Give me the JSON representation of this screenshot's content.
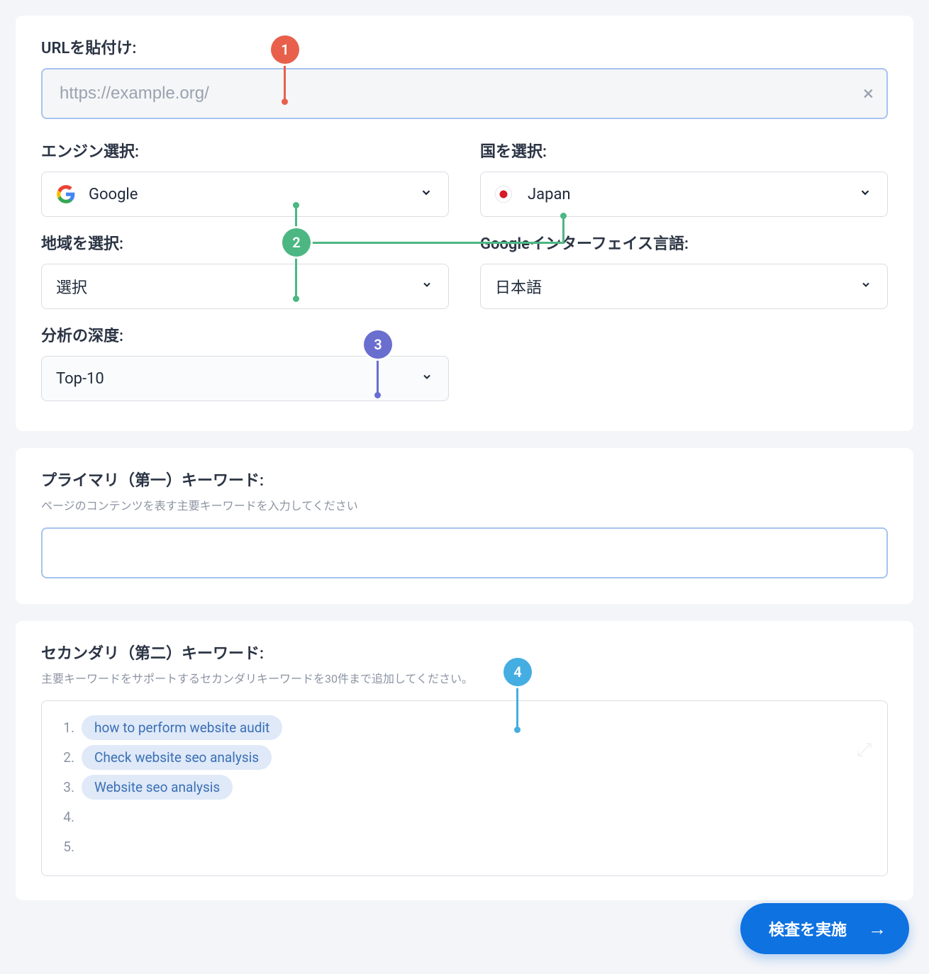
{
  "urlSection": {
    "label": "URLを貼付け:",
    "placeholder": "https://example.org/"
  },
  "engine": {
    "label": "エンジン選択:",
    "value": "Google"
  },
  "country": {
    "label": "国を選択:",
    "value": "Japan"
  },
  "region": {
    "label": "地域を選択:",
    "value": "選択"
  },
  "interfaceLang": {
    "label": "Googleインターフェイス言語:",
    "value": "日本語"
  },
  "depth": {
    "label": "分析の深度:",
    "value": "Top-10"
  },
  "primary": {
    "label": "プライマリ（第一）キーワード:",
    "sublabel": "ページのコンテンツを表す主要キーワードを入力してください",
    "value": ""
  },
  "secondary": {
    "label": "セカンダリ（第二）キーワード:",
    "sublabel": "主要キーワードをサポートするセカンダリキーワードを30件まで追加してください。",
    "items": [
      "how to perform website audit",
      "Check website seo analysis",
      "Website seo analysis",
      "",
      ""
    ],
    "rowNumbers": [
      "1.",
      "2.",
      "3.",
      "4.",
      "5."
    ]
  },
  "runButton": "検査を実施",
  "callouts": {
    "c1": "1",
    "c2": "2",
    "c3": "3",
    "c4": "4"
  }
}
